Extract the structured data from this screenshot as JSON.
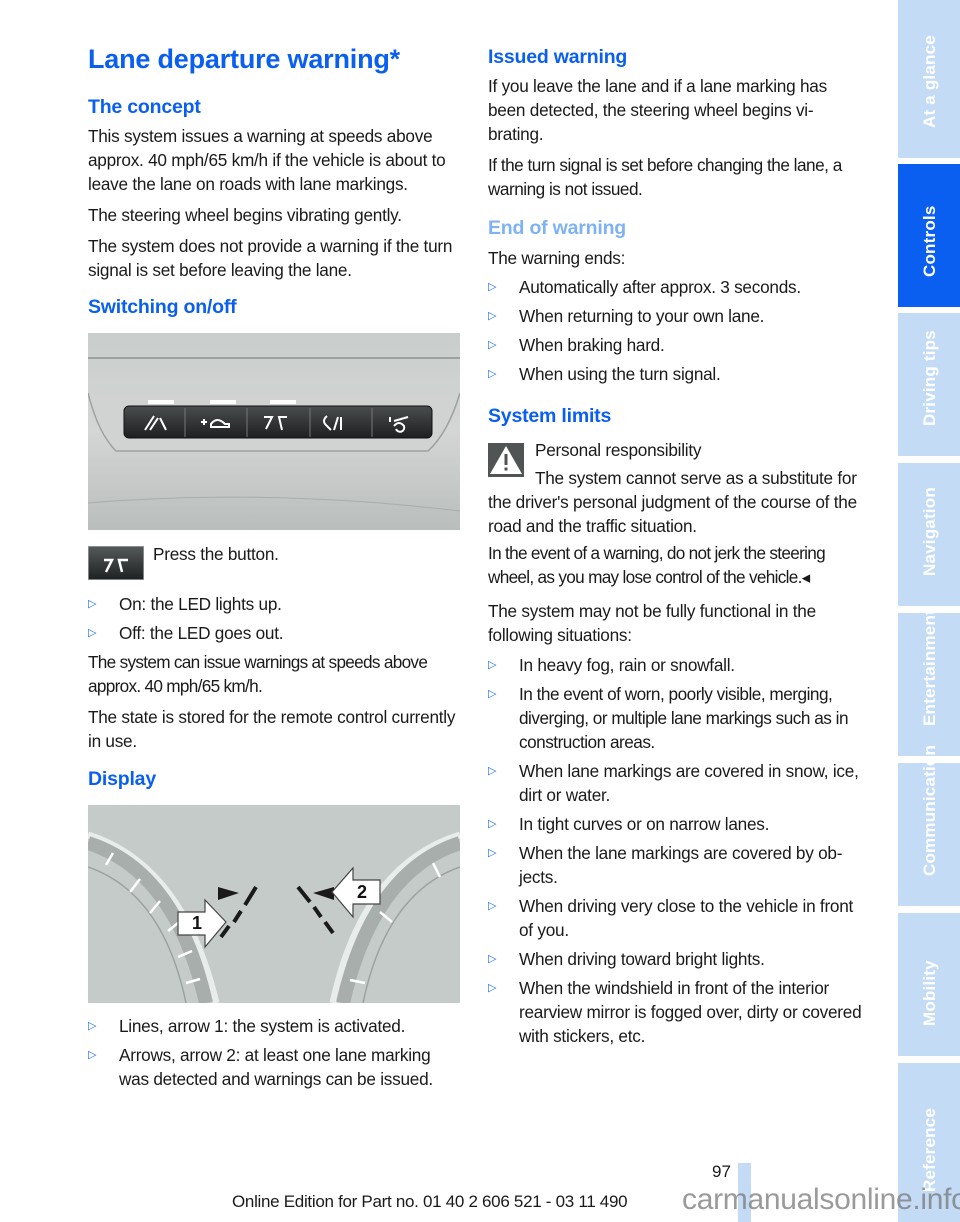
{
  "title": "Lane departure warning*",
  "left_column": {
    "concept": {
      "heading": "The concept",
      "paragraphs": [
        "This system issues a warning at speeds above approx. 40 mph/65 km/h if the vehicle is about to leave the lane on roads with lane markings.",
        "The steering wheel begins vibrating gently.",
        "The system does not provide a warning if the turn signal is set before leaving the lane."
      ]
    },
    "switching": {
      "heading": "Switching on/off",
      "button_panel_image": "overhead-button-panel-photo",
      "button_icon": "lane-departure-button-icon",
      "press_text": "Press the button.",
      "bullets": [
        "On: the LED lights up.",
        "Off: the LED goes out."
      ],
      "paragraphs": [
        "The system can issue warnings at speeds above approx. 40 mph/65 km/h.",
        "The state is stored for the remote control cur­rently in use."
      ]
    },
    "display": {
      "heading": "Display",
      "image": "instrument-cluster-lane-display",
      "callouts": [
        "1",
        "2"
      ],
      "bullets": [
        "Lines, arrow 1: the system is activated.",
        "Arrows, arrow 2: at least one lane marking was detected and warnings can be issued."
      ]
    }
  },
  "right_column": {
    "issued": {
      "heading": "Issued warning",
      "paragraphs": [
        "If you leave the lane and if a lane marking has been detected, the steering wheel begins vi­brating.",
        "If the turn signal is set before changing the lane, a warning is not issued."
      ]
    },
    "end": {
      "heading": "End of warning",
      "intro": "The warning ends:",
      "bullets": [
        "Automatically after approx. 3 seconds.",
        "When returning to your own lane.",
        "When braking hard.",
        "When using the turn signal."
      ]
    },
    "limits": {
      "heading": "System limits",
      "warning_title": "Personal responsibility",
      "warning_text": "The system cannot serve as a substitute for the driver's personal judgment of the course of the road and the traffic situation.",
      "warning_text2": "In the event of a warning, do not jerk the steering wheel, as you may lose control of the vehicle.◂",
      "intro": "The system may not be fully functional in the following situations:",
      "bullets": [
        "In heavy fog, rain or snowfall.",
        "In the event of worn, poorly visible, merging, diverging, or multiple lane markings such as in construction areas.",
        "When lane markings are covered in snow, ice, dirt or water.",
        "In tight curves or on narrow lanes.",
        "When the lane markings are covered by ob­jects.",
        "When driving very close to the vehicle in front of you.",
        "When driving toward bright lights.",
        "When the windshield in front of the interior rearview mirror is fogged over, dirty or cov­ered with stickers, etc."
      ]
    }
  },
  "sidebar": {
    "active": "Controls",
    "tabs": [
      "At a glance",
      "Controls",
      "Driving tips",
      "Navigation",
      "Entertainment",
      "Communication",
      "Mobility",
      "Reference"
    ]
  },
  "footer": {
    "page_number": "97",
    "edition": "Online Edition for Part no. 01 40 2 606 521 - 03 11 490",
    "watermark": "carmanualsonline.info"
  },
  "colors": {
    "heading_blue": "#0a5ff0",
    "heading_light_blue": "#7eb2f5",
    "tab_inactive": "#c4dbf6",
    "tab_active": "#0a5ff0"
  }
}
